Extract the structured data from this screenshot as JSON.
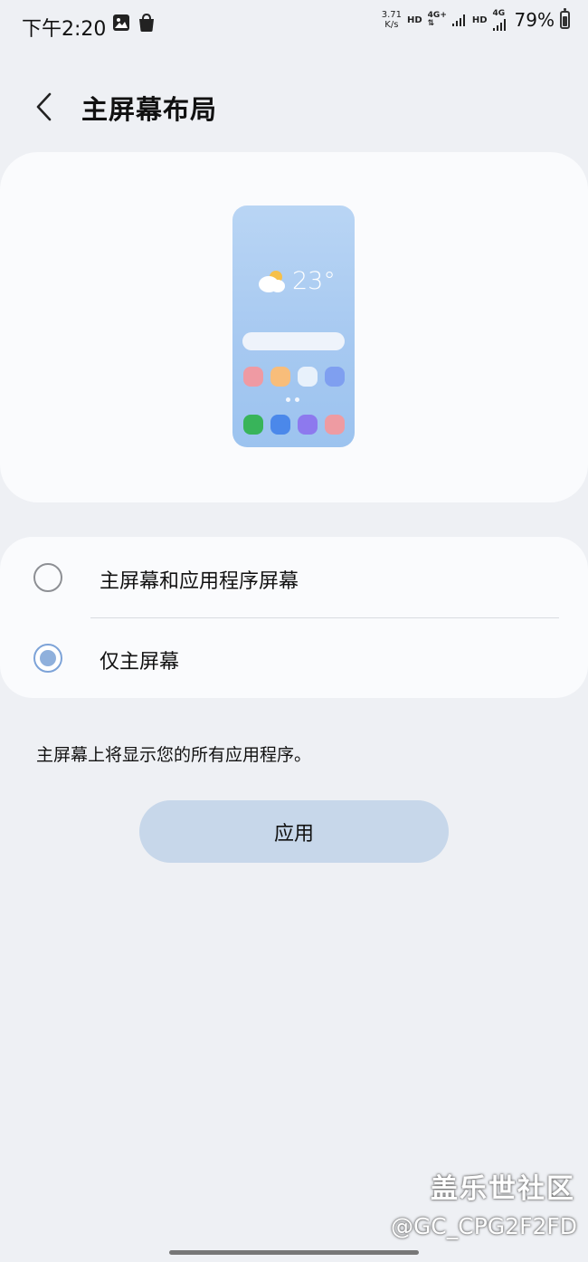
{
  "status_bar": {
    "time": "下午2:20",
    "speed_value": "3.71",
    "speed_unit": "K/s",
    "hd1": "HD",
    "net1": "4G+",
    "hd2": "HD",
    "net2": "4G",
    "battery": "79%"
  },
  "header": {
    "title": "主屏幕布局"
  },
  "preview": {
    "temperature": "23°",
    "app_row_1_colors": [
      "#ef9aa3",
      "#f8bd7a",
      "#e8f1fb",
      "#7f9ff0"
    ],
    "app_row_2_colors": [
      "#38b45a",
      "#4b88ea",
      "#8d79ee",
      "#ee9ba2"
    ]
  },
  "options": [
    {
      "label": "主屏幕和应用程序屏幕",
      "selected": false
    },
    {
      "label": "仅主屏幕",
      "selected": true
    }
  ],
  "description": "主屏幕上将显示您的所有应用程序。",
  "apply_label": "应用",
  "watermark": {
    "title": "盖乐世社区",
    "user": "@GC_CPG2F2FD"
  },
  "colors": {
    "background": "#eef0f4",
    "accent": "#8fb0dc",
    "button": "#c7d7ea"
  }
}
